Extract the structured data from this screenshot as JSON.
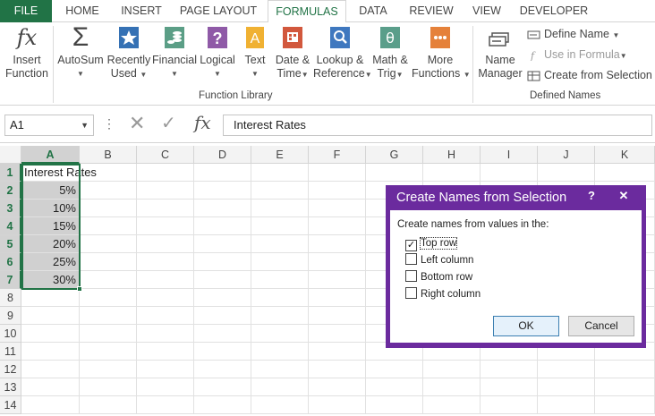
{
  "tabs": [
    "FILE",
    "HOME",
    "INSERT",
    "PAGE LAYOUT",
    "FORMULAS",
    "DATA",
    "REVIEW",
    "VIEW",
    "DEVELOPER"
  ],
  "active_tab": "FORMULAS",
  "ribbon": {
    "insert_function": [
      "Insert",
      "Function"
    ],
    "fx_glyph": "fx",
    "function_library": {
      "autosum": "AutoSum",
      "recently_used": [
        "Recently",
        "Used"
      ],
      "financial": "Financial",
      "logical": "Logical",
      "text": "Text",
      "date_time": [
        "Date &",
        "Time"
      ],
      "lookup_reference": [
        "Lookup &",
        "Reference"
      ],
      "math_trig": [
        "Math &",
        "Trig"
      ],
      "more_functions": [
        "More",
        "Functions"
      ],
      "group_label": "Function Library"
    },
    "defined_names": {
      "name_manager": [
        "Name",
        "Manager"
      ],
      "define_name": "Define Name",
      "use_in_formula": "Use in Formula",
      "create_from_selection": "Create from Selection",
      "group_label": "Defined Names"
    },
    "colors": {
      "excel_green": "#217346",
      "autosum": "#444444",
      "recently_used": "#3571b4",
      "financial": "#5b9e86",
      "logical": "#8f5aa7",
      "text": "#f0b132",
      "date_time": "#d2583d",
      "lookup": "#3f78bf",
      "math_trig": "#5a9e8a",
      "more_functions": "#e5813a"
    }
  },
  "formula_bar": {
    "name_box": "A1",
    "dots": "⋮",
    "cancel_glyph": "✕",
    "enter_glyph": "✓",
    "fx_glyph": "fx",
    "content": "Interest Rates"
  },
  "sheet": {
    "columns": [
      "A",
      "B",
      "C",
      "D",
      "E",
      "F",
      "G",
      "H",
      "I",
      "J",
      "K"
    ],
    "rows": [
      "1",
      "2",
      "3",
      "4",
      "5",
      "6",
      "7",
      "8",
      "9",
      "10",
      "11",
      "12",
      "13",
      "14"
    ],
    "a1": "Interest Rates",
    "a_values": [
      "5%",
      "10%",
      "15%",
      "20%",
      "25%",
      "30%"
    ]
  },
  "dialog": {
    "title": "Create Names from Selection",
    "help": "?",
    "close": "✕",
    "prompt": "Create names from values in the:",
    "check_glyph": "✓",
    "options": [
      {
        "label": "Top row",
        "checked": true
      },
      {
        "label": "Left column",
        "checked": false
      },
      {
        "label": "Bottom row",
        "checked": false
      },
      {
        "label": "Right column",
        "checked": false
      }
    ],
    "ok": "OK",
    "cancel": "Cancel"
  }
}
